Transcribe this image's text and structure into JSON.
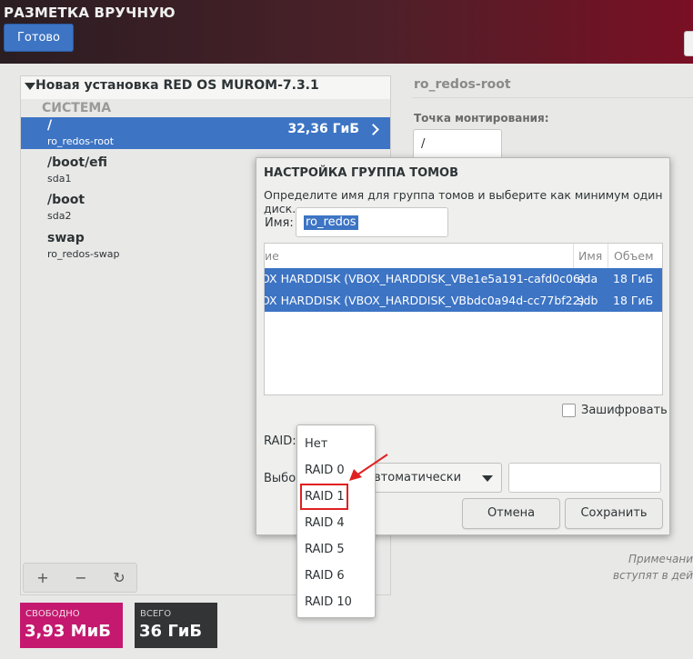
{
  "header": {
    "title": "РАЗМЕТКА ВРУЧНУЮ",
    "done_label": "Готово"
  },
  "tree": {
    "title": "Новая установка RED OS MUROM-7.3.1",
    "system_label": "СИСТЕМА",
    "mounts": [
      {
        "name": "/",
        "device": "ro_redos-root",
        "size": "32,36 ГиБ"
      },
      {
        "name": "/boot/efi",
        "device": "sda1"
      },
      {
        "name": "/boot",
        "device": "sda2"
      },
      {
        "name": "swap",
        "device": "ro_redos-swap"
      }
    ]
  },
  "toolbar": {
    "add": "+",
    "remove": "−",
    "refresh": "↻"
  },
  "storage": {
    "free_label": "СВОБОДНО",
    "free_value": "3,93 МиБ",
    "total_label": "ВСЕГО",
    "total_value": "36 ГиБ"
  },
  "right": {
    "title": "ro_redos-root",
    "mount_point_label": "Точка монтирования:",
    "mount_point_value": "/",
    "note_line1": "Примечани",
    "note_line2": "вступят в дей"
  },
  "dialog": {
    "title": "НАСТРОЙКА ГРУППА ТОМОВ",
    "description": "Определите имя для группа томов и выберите как минимум один диск.",
    "name_label": "Имя:",
    "name_value": "ro_redos",
    "columns": [
      "ие",
      "Имя",
      "Объем"
    ],
    "disks": [
      {
        "description": "OX HARDDISK (VBOX_HARDDISK_VBe1e5a191-cafd0c06)",
        "name": "sda",
        "size": "18 ГиБ"
      },
      {
        "description": "OX HARDDISK (VBOX_HARDDISK_VBbdc0a94d-cc77bf22)",
        "name": "sdb",
        "size": "18 ГиБ"
      }
    ],
    "encrypt_label": "Зашифровать",
    "raid_label": "RAID:",
    "select_label": "Выбор",
    "size_policy_value": "втоматически",
    "cancel_label": "Отмена",
    "save_label": "Сохранить"
  },
  "raid_options": [
    "Нет",
    "RAID 0",
    "RAID 1",
    "RAID 4",
    "RAID 5",
    "RAID 6",
    "RAID 10"
  ],
  "colors": {
    "accent": "#3d74c4",
    "free_box": "#c4196f",
    "total_box": "#333436",
    "highlight": "#e02020"
  }
}
